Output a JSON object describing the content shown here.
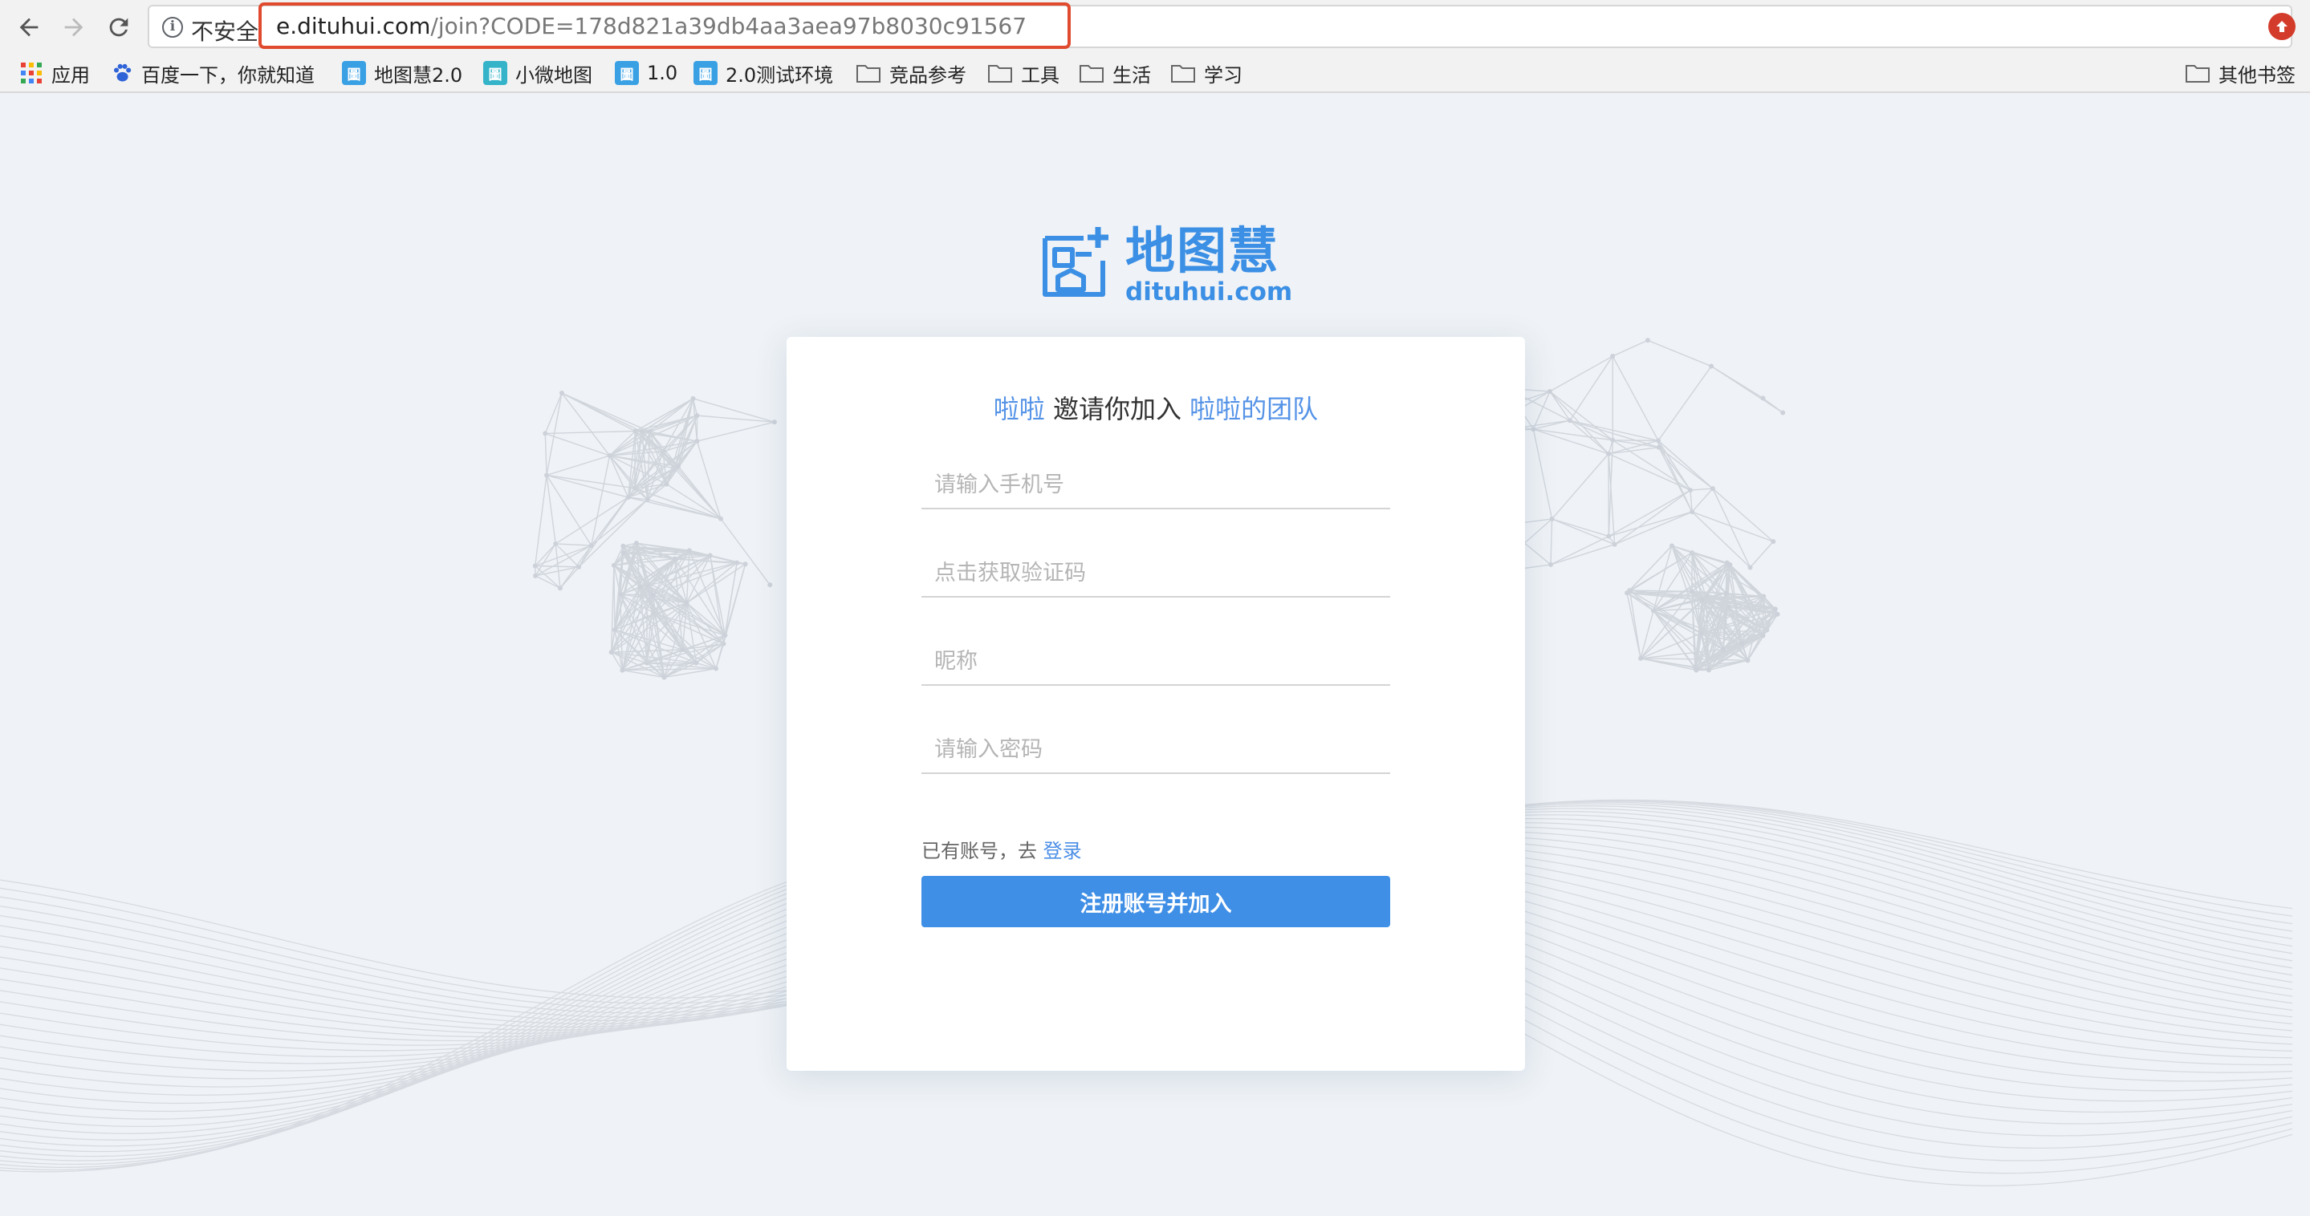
{
  "browser": {
    "security_label": "不安全",
    "url_host": "e.dituhui.com",
    "url_path": "/join?CODE=178d821a39db4aa3aea97b8030c91567"
  },
  "bookmarks": {
    "apps": "应用",
    "items": [
      {
        "label": "百度一下，你就知道",
        "icon": "baidu-paw-icon"
      },
      {
        "label": "地图慧2.0",
        "icon": "dituhui-site-icon"
      },
      {
        "label": "小微地图",
        "icon": "dituhui-site-icon"
      },
      {
        "label": "1.0",
        "icon": "dituhui-site-icon"
      },
      {
        "label": "2.0测试环境",
        "icon": "dituhui-site-icon"
      },
      {
        "label": "竞品参考",
        "icon": "folder-icon"
      },
      {
        "label": "工具",
        "icon": "folder-icon"
      },
      {
        "label": "生活",
        "icon": "folder-icon"
      },
      {
        "label": "学习",
        "icon": "folder-icon"
      }
    ],
    "other": "其他书签"
  },
  "logo": {
    "name_cn": "地图慧",
    "domain": "dituhui.com",
    "color": "#3b8fe4"
  },
  "invite": {
    "inviter": "啦啦",
    "text": " 邀请你加入 ",
    "team": "啦啦的团队"
  },
  "form": {
    "phone_placeholder": "请输入手机号",
    "code_placeholder": "点击获取验证码",
    "nickname_placeholder": "昵称",
    "password_placeholder": "请输入密码",
    "have_account": "已有账号，去 ",
    "login_link": "登录",
    "submit_label": "注册账号并加入",
    "submit_color": "#3f8fe6"
  }
}
